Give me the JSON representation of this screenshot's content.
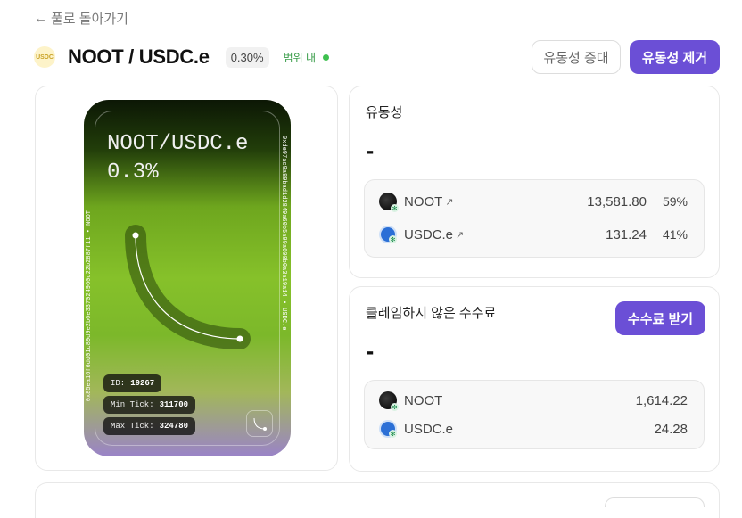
{
  "nav": {
    "back_label": "풀로 돌아가기"
  },
  "header": {
    "logo_text": "USDC",
    "pool_name": "NOOT / USDC.e",
    "fee_tier": "0.30%",
    "range_status": "범위 내",
    "range_color": "#3ec04f",
    "increase_label": "유동성 증대",
    "remove_label": "유동성 제거"
  },
  "nft": {
    "title": "NOOT/USDC.e",
    "fee": "0.3%",
    "address_right": "0xde97ac9a89bad1d2849a60b5a99a600b0a3a19a14 • USDC.e",
    "address_left": "0x85ea16f6dd01c89d9e2b0e337024960c22b2887f11 • NOOT",
    "id_label": "ID:",
    "id_value": "19267",
    "min_tick_label": "Min Tick:",
    "min_tick_value": "311700",
    "max_tick_label": "Max Tick:",
    "max_tick_value": "324780"
  },
  "liquidity": {
    "title": "유동성",
    "value": "-",
    "tokens": [
      {
        "symbol": "NOOT",
        "arrow": "↗",
        "amount": "13,581.80",
        "percent": "59%",
        "icon": "noot-token-icon"
      },
      {
        "symbol": "USDC.e",
        "arrow": "↗",
        "amount": "131.24",
        "percent": "41%",
        "icon": "usdc-token-icon"
      }
    ]
  },
  "fees": {
    "title": "클레임하지 않은 수수료",
    "value": "-",
    "claim_label": "수수료 받기",
    "tokens": [
      {
        "symbol": "NOOT",
        "amount": "1,614.22"
      },
      {
        "symbol": "USDC.e",
        "amount": "24.28"
      }
    ]
  },
  "colors": {
    "accent": "#6b4fd6",
    "in_range": "#3ec04f"
  }
}
